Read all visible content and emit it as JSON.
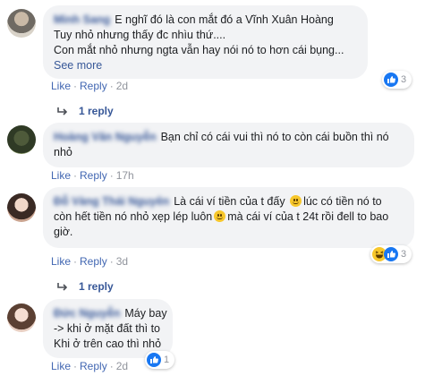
{
  "comments": [
    {
      "author": "Minh Sang",
      "lines": [
        "E nghĩ đó là con mắt đó a Vĩnh Xuân Hoàng",
        "Tuy nhỏ nhưng thấy đc nhìu thứ....",
        "Con mắt nhỏ nhưng ngta vẫn hay nói nó to hơn cái bụng..."
      ],
      "see_more": "See more",
      "like": "Like",
      "reply": "Reply",
      "time": "2d",
      "reaction_count": "3",
      "reaction_type": "like",
      "replies_label": "1 reply"
    },
    {
      "author": "Hoàng Văn Nguyễn",
      "lines": [
        "Bạn chỉ có cái vui thì nó to còn cái buồn thì nó",
        "nhỏ"
      ],
      "like": "Like",
      "reply": "Reply",
      "time": "17h"
    },
    {
      "author": "Đỗ Vàng Thái Nguyên",
      "lines": [
        "Là cái ví tiền của t đấy",
        "lúc có tiền nó to",
        "còn hết tiền nó nhỏ xẹp lép luôn",
        "mà cái ví của t 24t rồi đell to bao",
        "giờ."
      ],
      "like": "Like",
      "reply": "Reply",
      "time": "3d",
      "reaction_count": "3",
      "reaction_type": "haha+like",
      "replies_label": "1 reply"
    },
    {
      "author": "Đức Nguyễn",
      "lines": [
        "Máy bay",
        "-> khi ở mặt đất thì to",
        "Khi ở trên cao thì nhỏ"
      ],
      "like": "Like",
      "reply": "Reply",
      "time": "2d",
      "reaction_count": "1",
      "reaction_type": "like"
    }
  ],
  "colors": {
    "link": "#4267b2",
    "name": "#385898",
    "bubble": "#f2f3f5",
    "meta": "#90949c",
    "like_blue": "#1877f2"
  }
}
